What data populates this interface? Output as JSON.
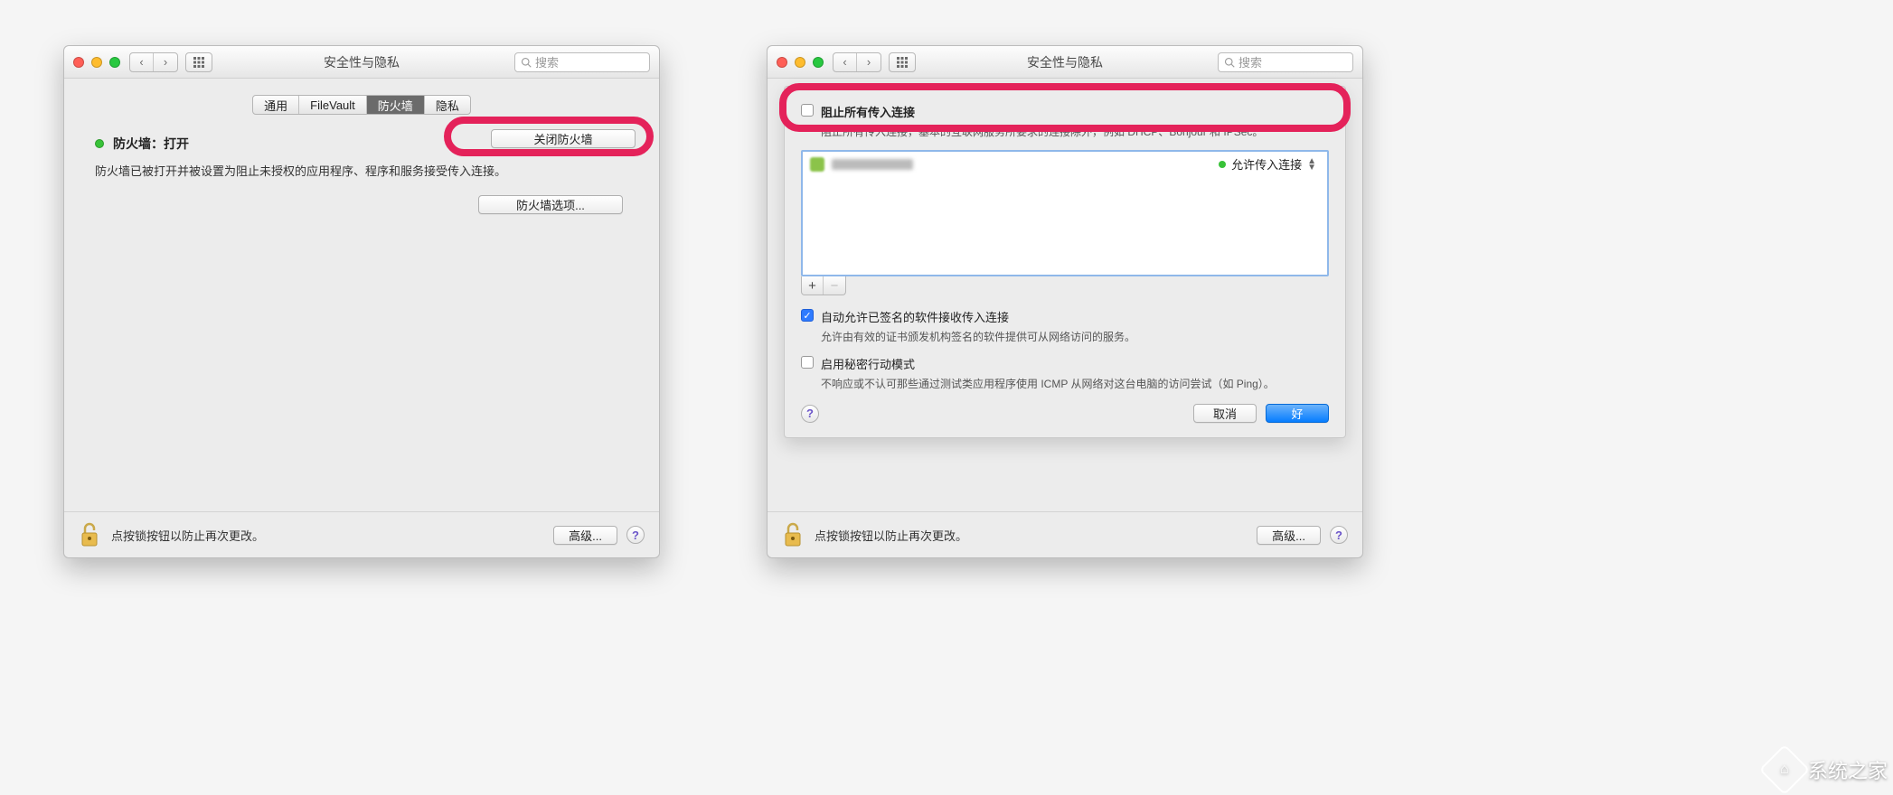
{
  "window": {
    "title": "安全性与隐私",
    "search_placeholder": "搜索"
  },
  "left": {
    "tabs": [
      "通用",
      "FileVault",
      "防火墙",
      "隐私"
    ],
    "active_tab_index": 2,
    "status_label": "防火墙：打开",
    "description": "防火墙已被打开并被设置为阻止未授权的应用程序、程序和服务接受传入连接。",
    "button_turn_off": "关闭防火墙",
    "button_options": "防火墙选项...",
    "lock_text": "点按锁按钮以防止再次更改。",
    "advanced_button": "高级..."
  },
  "right": {
    "block_all": {
      "checked": false,
      "label": "阻止所有传入连接",
      "sub": "阻止所有传入连接，基本的互联网服务所要求的连接除外，例如 DHCP、Bonjour 和 IPSec。"
    },
    "app_list": {
      "items": [
        {
          "name_blurred": true,
          "permission": "允许传入连接"
        }
      ]
    },
    "add_label": "+",
    "remove_label": "−",
    "auto_allow": {
      "checked": true,
      "label": "自动允许已签名的软件接收传入连接",
      "sub": "允许由有效的证书颁发机构签名的软件提供可从网络访问的服务。"
    },
    "stealth": {
      "checked": false,
      "label": "启用秘密行动模式",
      "sub": "不响应或不认可那些通过测试类应用程序使用 ICMP 从网络对这台电脑的访问尝试（如 Ping）。"
    },
    "cancel_button": "取消",
    "ok_button": "好",
    "lock_text": "点按锁按钮以防止再次更改。",
    "advanced_button": "高级..."
  },
  "watermark_text": "系统之家"
}
